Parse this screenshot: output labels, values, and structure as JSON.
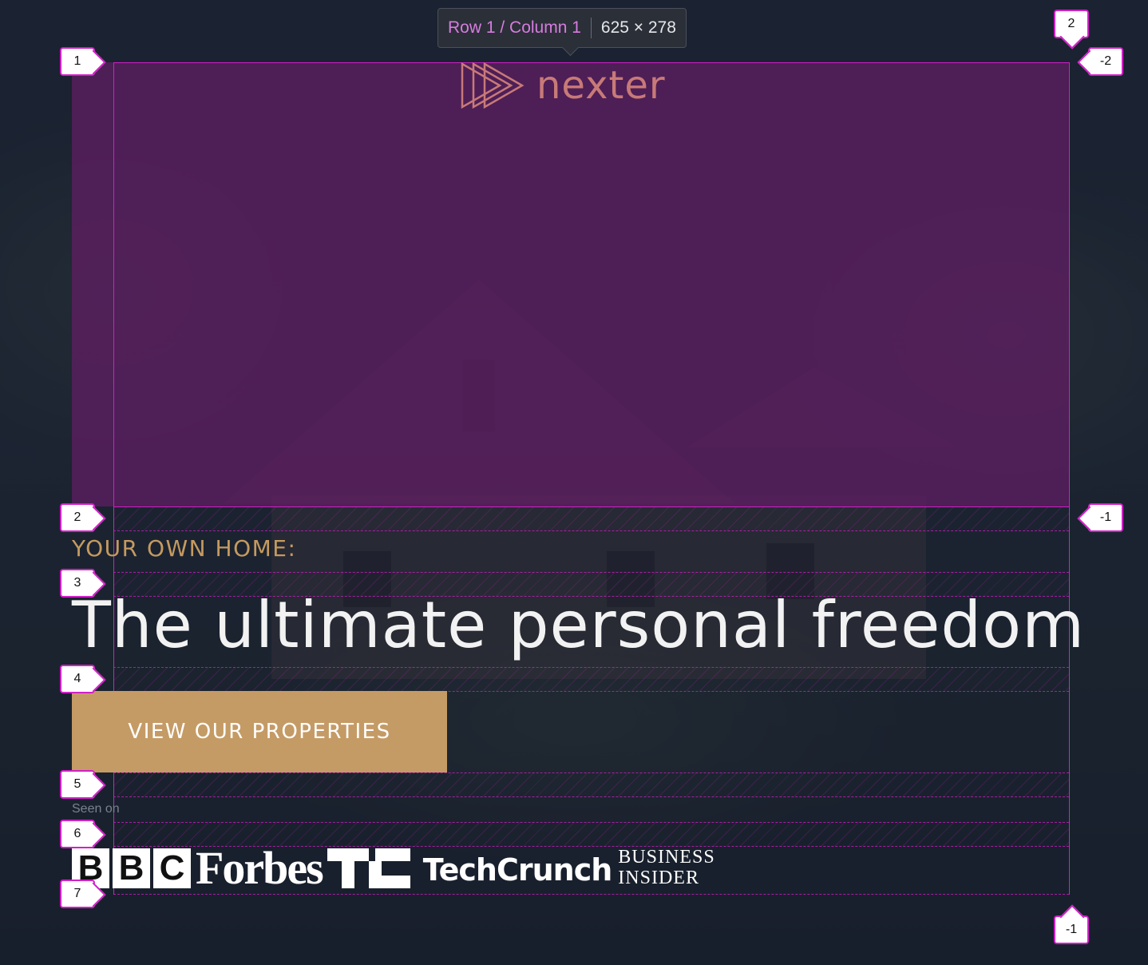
{
  "tooltip": {
    "area": "Row 1 / Column 1",
    "size": "625 × 278"
  },
  "logo": {
    "text": "nexter"
  },
  "hero": {
    "subtitle": "YOUR OWN HOME:",
    "headline": "The ultimate personal freedom",
    "cta_label": "VIEW OUR PROPERTIES",
    "seen_on": "Seen on"
  },
  "press": {
    "bbc_letters": [
      "B",
      "B",
      "C"
    ],
    "forbes": "Forbes",
    "techcrunch": "TechCrunch",
    "business": "BUSINESS",
    "insider": "INSIDER"
  },
  "grid_badges": {
    "left": [
      "1",
      "2",
      "3",
      "4",
      "5",
      "6",
      "7"
    ],
    "top_right": "2",
    "right_top": "-2",
    "right_mid": "-1",
    "bottom_right": "-1"
  },
  "colors": {
    "accent": "#c59b65",
    "grid": "#d21fc8",
    "logo": "#c87a78"
  }
}
